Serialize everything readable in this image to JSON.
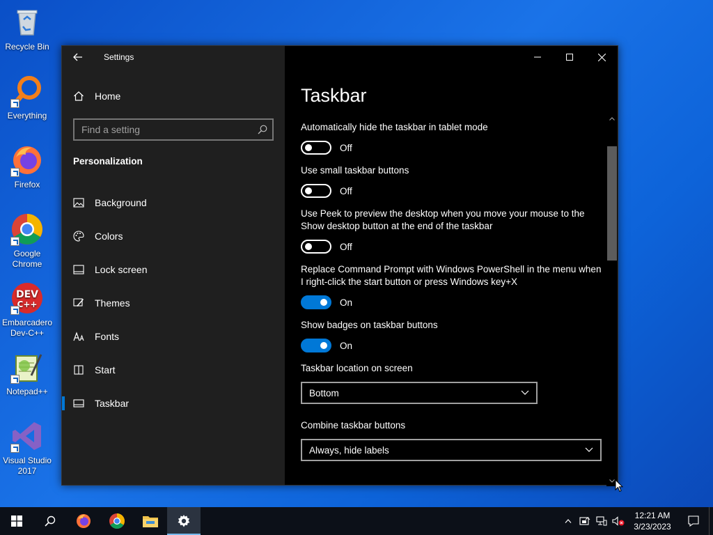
{
  "desktop": {
    "icons": [
      {
        "label": "Recycle Bin",
        "icon": "recycle-bin-icon"
      },
      {
        "label": "Everything",
        "icon": "everything-search-icon"
      },
      {
        "label": "Firefox",
        "icon": "firefox-icon"
      },
      {
        "label": "Google Chrome",
        "icon": "chrome-icon"
      },
      {
        "label": "Embarcadero Dev-C++",
        "icon": "devcpp-icon"
      },
      {
        "label": "Notepad++",
        "icon": "notepadpp-icon"
      },
      {
        "label": "Visual Studio 2017",
        "icon": "visual-studio-icon"
      }
    ]
  },
  "window": {
    "app_title": "Settings",
    "sidebar": {
      "home_label": "Home",
      "search_placeholder": "Find a setting",
      "section_title": "Personalization",
      "items": [
        {
          "label": "Background",
          "icon": "background-image-icon"
        },
        {
          "label": "Colors",
          "icon": "palette-icon"
        },
        {
          "label": "Lock screen",
          "icon": "lock-screen-icon"
        },
        {
          "label": "Themes",
          "icon": "themes-brush-icon"
        },
        {
          "label": "Fonts",
          "icon": "fonts-icon"
        },
        {
          "label": "Start",
          "icon": "start-grid-icon"
        },
        {
          "label": "Taskbar",
          "icon": "taskbar-icon",
          "active": true
        }
      ]
    },
    "content": {
      "title": "Taskbar",
      "settings": [
        {
          "label": "Automatically hide the taskbar in tablet mode",
          "state": "Off"
        },
        {
          "label": "Use small taskbar buttons",
          "state": "Off"
        },
        {
          "label": "Use Peek to preview the desktop when you move your mouse to the Show desktop button at the end of the taskbar",
          "state": "Off"
        },
        {
          "label": "Replace Command Prompt with Windows PowerShell in the menu when I right-click the start button or press Windows key+X",
          "state": "On"
        },
        {
          "label": "Show badges on taskbar buttons",
          "state": "On"
        }
      ],
      "location": {
        "label": "Taskbar location on screen",
        "value": "Bottom"
      },
      "combine": {
        "label": "Combine taskbar buttons",
        "value": "Always, hide labels"
      }
    }
  },
  "taskbar": {
    "clock_time": "12:21 AM",
    "clock_date": "3/23/2023"
  },
  "colors": {
    "accent": "#0078d7",
    "sidebar_bg": "#1f1f1f",
    "content_bg": "#000000",
    "taskbar_bg": "#0c1018"
  }
}
